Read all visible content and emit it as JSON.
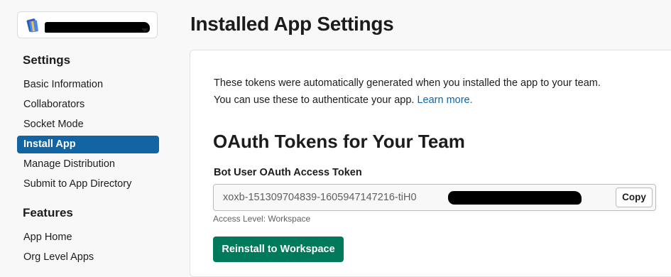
{
  "workspace": {
    "name": "",
    "name_redacted": true
  },
  "sidebar": {
    "settings_title": "Settings",
    "settings_items": [
      {
        "label": "Basic Information",
        "active": false
      },
      {
        "label": "Collaborators",
        "active": false
      },
      {
        "label": "Socket Mode",
        "active": false
      },
      {
        "label": "Install App",
        "active": true
      },
      {
        "label": "Manage Distribution",
        "active": false
      },
      {
        "label": "Submit to App Directory",
        "active": false
      }
    ],
    "features_title": "Features",
    "features_items": [
      {
        "label": "App Home"
      },
      {
        "label": "Org Level Apps"
      }
    ]
  },
  "main": {
    "page_title": "Installed App Settings",
    "intro_line1": "These tokens were automatically generated when you installed the app to your team.",
    "intro_line2": "You can use these to authenticate your app.",
    "learn_more": "Learn more.",
    "oauth_heading": "OAuth Tokens for Your Team",
    "bot_token_label": "Bot User OAuth Access Token",
    "bot_token_value": "xoxb-151309704839-1605947147216-tiH0",
    "copy_label": "Copy",
    "access_level": "Access Level: Workspace",
    "reinstall_label": "Reinstall to Workspace"
  },
  "colors": {
    "active_nav": "#1264a3",
    "link": "#1264a3",
    "primary_button": "#007a5a"
  },
  "icons": {
    "app": "app-book-icon",
    "dropdown": "chevron-down-icon"
  }
}
